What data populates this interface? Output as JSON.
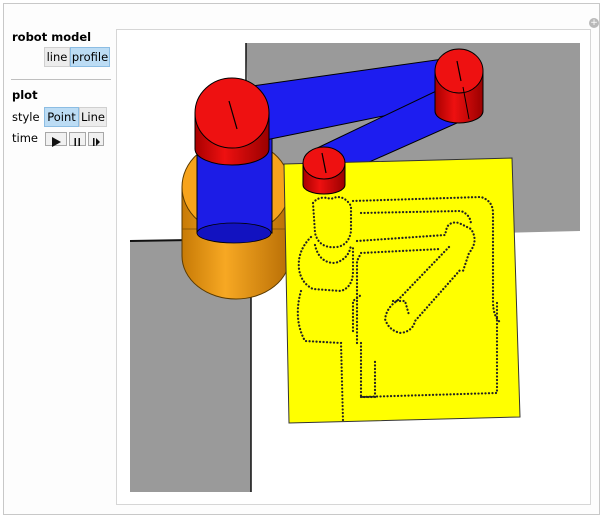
{
  "robot_model": {
    "title": "robot model",
    "options": [
      "line",
      "profile"
    ],
    "selected": "profile"
  },
  "plot": {
    "title": "plot",
    "style_label": "style",
    "style_options": [
      "Point",
      "Line"
    ],
    "style_selected": "Point",
    "time_label": "time",
    "time_controls": [
      "play-icon",
      "pause-icon",
      "step-to-end-icon"
    ]
  },
  "colors": {
    "joint": "#ee0000",
    "link": "#1d1dee",
    "base": "#f39a0f",
    "paper": "#ffff00",
    "floor": "#9a9a9a",
    "selected_button": "#bcdcf4"
  }
}
